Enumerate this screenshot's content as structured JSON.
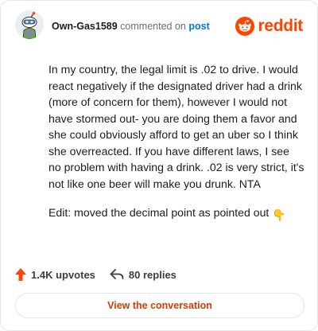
{
  "header": {
    "username": "Own-Gas1589",
    "action_text": "commented on",
    "post_link": "post",
    "brand_name": "reddit"
  },
  "comment": {
    "paragraphs": [
      "In my country, the legal limit is .02 to drive. I would react negatively if the designated driver had a drink (more of concern for them), however I would not have stormed out- you are doing them a favor and she could obviously afford to get an uber so I think she overreacted. If you have different laws, I see no problem with having a drink. .02 is very strict, it's not like one beer will make you drunk. NTA",
      "Edit: moved the decimal point as pointed out"
    ],
    "edit_emoji": "👇"
  },
  "stats": {
    "upvotes": "1.4K upvotes",
    "replies": "80 replies"
  },
  "cta": {
    "label": "View the conversation"
  },
  "colors": {
    "brand": "#ff4500",
    "link": "#0079d3",
    "cta_text": "#d93a00",
    "border": "#e3e6e8"
  },
  "icons": {
    "avatar": "snoo-avatar-icon",
    "brand": "reddit-logo-icon",
    "upvote": "upvote-arrow-icon",
    "reply": "reply-arrow-icon",
    "emoji": "pointing-down-hand-icon"
  }
}
